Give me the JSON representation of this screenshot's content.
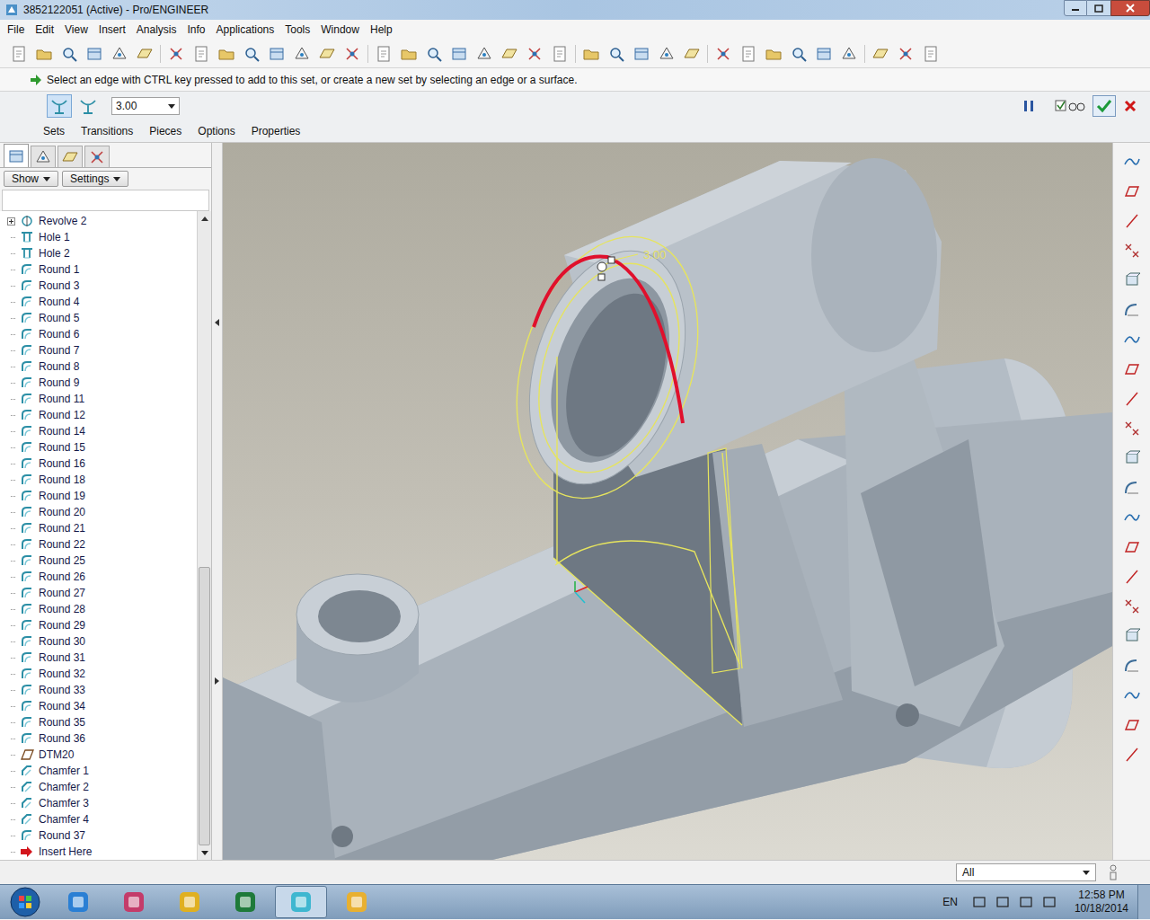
{
  "window": {
    "title": "3852122051 (Active) - Pro/ENGINEER"
  },
  "menu": [
    "File",
    "Edit",
    "View",
    "Insert",
    "Analysis",
    "Info",
    "Applications",
    "Tools",
    "Window",
    "Help"
  ],
  "dashboard": {
    "prompt": "Select an edge with CTRL key pressed to add to this set, or create a new set by selecting an edge or a surface.",
    "modes": [
      {
        "selected": true
      },
      {
        "selected": false
      }
    ],
    "value": "3.00",
    "tabs": [
      {
        "label": "Sets",
        "selected": false
      },
      {
        "label": "Transitions",
        "selected": false
      },
      {
        "label": "Pieces",
        "selected": false
      },
      {
        "label": "Options",
        "selected": false
      },
      {
        "label": "Properties",
        "selected": false
      }
    ]
  },
  "model_tree": {
    "buttons": [
      "Show",
      "Settings"
    ],
    "items": [
      {
        "label": "Revolve 2",
        "kind": "revolve",
        "expanded": false
      },
      {
        "label": "Hole 1",
        "kind": "hole",
        "expanded": false
      },
      {
        "label": "Hole 2",
        "kind": "hole",
        "expanded": false
      },
      {
        "label": "Round 1",
        "kind": "round",
        "expanded": false
      },
      {
        "label": "Round 3",
        "kind": "round",
        "expanded": false
      },
      {
        "label": "Round 4",
        "kind": "round",
        "expanded": false
      },
      {
        "label": "Round 5",
        "kind": "round",
        "expanded": false
      },
      {
        "label": "Round 6",
        "kind": "round",
        "expanded": false
      },
      {
        "label": "Round 7",
        "kind": "round",
        "expanded": false
      },
      {
        "label": "Round 8",
        "kind": "round",
        "expanded": false
      },
      {
        "label": "Round 9",
        "kind": "round",
        "expanded": false
      },
      {
        "label": "Round 11",
        "kind": "round",
        "expanded": false
      },
      {
        "label": "Round 12",
        "kind": "round",
        "expanded": false
      },
      {
        "label": "Round 14",
        "kind": "round",
        "expanded": false
      },
      {
        "label": "Round 15",
        "kind": "round",
        "expanded": false
      },
      {
        "label": "Round 16",
        "kind": "round",
        "expanded": false
      },
      {
        "label": "Round 18",
        "kind": "round",
        "expanded": false
      },
      {
        "label": "Round 19",
        "kind": "round",
        "expanded": false
      },
      {
        "label": "Round 20",
        "kind": "round",
        "expanded": false
      },
      {
        "label": "Round 21",
        "kind": "round",
        "expanded": false
      },
      {
        "label": "Round 22",
        "kind": "round",
        "expanded": false
      },
      {
        "label": "Round 25",
        "kind": "round",
        "expanded": false
      },
      {
        "label": "Round 26",
        "kind": "round",
        "expanded": false
      },
      {
        "label": "Round 27",
        "kind": "round",
        "expanded": false
      },
      {
        "label": "Round 28",
        "kind": "round",
        "expanded": false
      },
      {
        "label": "Round 29",
        "kind": "round",
        "expanded": false
      },
      {
        "label": "Round 30",
        "kind": "round",
        "expanded": false
      },
      {
        "label": "Round 31",
        "kind": "round",
        "expanded": false
      },
      {
        "label": "Round 32",
        "kind": "round",
        "expanded": false
      },
      {
        "label": "Round 33",
        "kind": "round",
        "expanded": false
      },
      {
        "label": "Round 34",
        "kind": "round",
        "expanded": false
      },
      {
        "label": "Round 35",
        "kind": "round",
        "expanded": false
      },
      {
        "label": "Round 36",
        "kind": "round",
        "expanded": false
      },
      {
        "label": "DTM20",
        "kind": "datum",
        "expanded": false
      },
      {
        "label": "Chamfer 1",
        "kind": "chamfer",
        "expanded": false
      },
      {
        "label": "Chamfer 2",
        "kind": "chamfer",
        "expanded": false
      },
      {
        "label": "Chamfer 3",
        "kind": "chamfer",
        "expanded": false
      },
      {
        "label": "Chamfer 4",
        "kind": "chamfer",
        "expanded": false
      },
      {
        "label": "Round 37",
        "kind": "round",
        "expanded": false
      },
      {
        "label": "Insert Here",
        "kind": "insert",
        "expanded": false
      }
    ]
  },
  "viewport": {
    "dimension": "3.00"
  },
  "status_bar": {
    "filter": "All"
  },
  "taskbar": {
    "language": "EN",
    "time": "12:58 PM",
    "date": "10/18/2014"
  }
}
